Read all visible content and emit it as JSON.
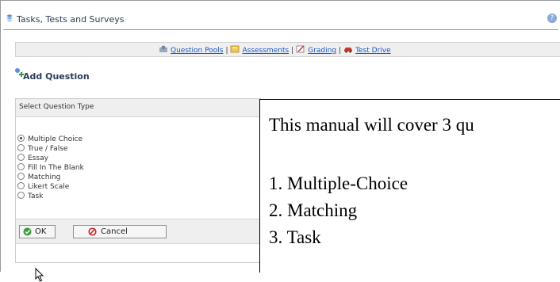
{
  "window": {
    "title": "Tasks, Tests and Surveys",
    "help_icon": "help-icon"
  },
  "nav": {
    "items": [
      {
        "label": "Question Pools",
        "icon": "question-pools-icon"
      },
      {
        "label": "Assessments",
        "icon": "assessments-icon"
      },
      {
        "label": "Grading",
        "icon": "grading-icon"
      },
      {
        "label": "Test Drive",
        "icon": "test-drive-icon"
      }
    ],
    "separator": "|",
    "link_color": "#1a56c6"
  },
  "page": {
    "heading": "Add Question"
  },
  "question_type_panel": {
    "header": "Select Question Type",
    "options": [
      {
        "label": "Multiple Choice",
        "selected": true
      },
      {
        "label": "True / False",
        "selected": false
      },
      {
        "label": "Essay",
        "selected": false
      },
      {
        "label": "Fill In The Blank",
        "selected": false
      },
      {
        "label": "Matching",
        "selected": false
      },
      {
        "label": "Likert Scale",
        "selected": false
      },
      {
        "label": "Task",
        "selected": false
      }
    ],
    "ok_label": "OK",
    "cancel_label": "Cancel"
  },
  "overlay": {
    "intro": "This manual will cover 3 qu",
    "items": [
      "1. Multiple-Choice",
      "2. Matching",
      "3. Task"
    ]
  },
  "colors": {
    "title_rule": "#5aa9d8",
    "panel_bg": "#efefef",
    "title_text": "#2b3b57"
  }
}
